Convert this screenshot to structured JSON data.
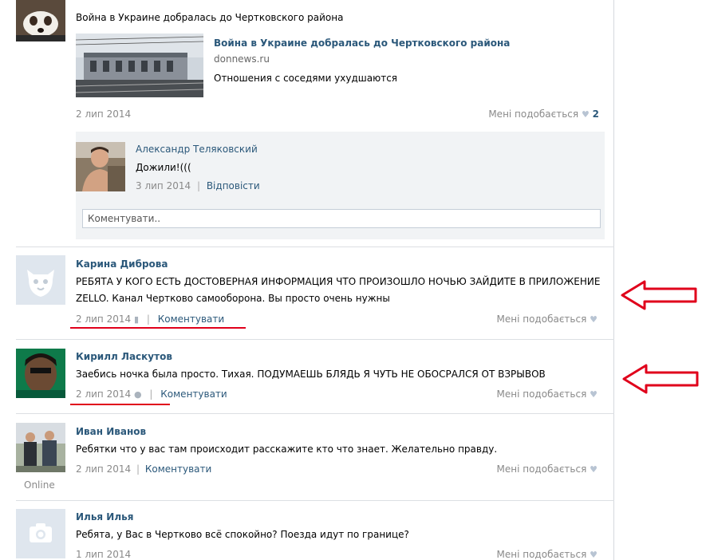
{
  "repost": {
    "text": "Война в Украине добралась до Чертковского района",
    "link_title": "Война в Украине добралась до Чертковского района",
    "link_domain": "donnews.ru",
    "link_desc": "Отношения с соседями ухудшаются",
    "date": "2 лип 2014",
    "likes_label": "Мені подобається",
    "likes_count": "2"
  },
  "reply": {
    "author": "Александр Теляковский",
    "text": "Дожили!(((",
    "date": "3 лип 2014",
    "reply_label": "Відповісти"
  },
  "comment_input": {
    "placeholder": "Коментувати.."
  },
  "comments": [
    {
      "name": "Карина Диброва",
      "text": "РЕБЯТА У КОГО ЕСТЬ ДОСТОВЕРНАЯ ИНФОРМАЦИЯ ЧТО ПРОИЗОШЛО НОЧЬЮ ЗАЙДИТЕ В ПРИЛОЖЕНИЕ ZELLO. Канал Чертково самооборона. Вы просто очень нужны",
      "date": "2 лип 2014",
      "comment_label": "Коментувати",
      "likes_label": "Мені подобається"
    },
    {
      "name": "Кирилл Ласкутов",
      "text": "Заебись ночка была просто. Тихая. ПОДУМАЕШЬ БЛЯДЬ Я ЧУТЬ НЕ ОБОСРАЛСЯ ОТ ВЗРЫВОВ",
      "date": "2 лип 2014",
      "comment_label": "Коментувати",
      "likes_label": "Мені подобається"
    },
    {
      "name": "Иван Иванов",
      "text": "Ребятки что у вас там происходит расскажите кто что знает. Желательно правду.",
      "date": "2 лип 2014",
      "comment_label": "Коментувати",
      "likes_label": "Мені подобається",
      "status": "Online"
    },
    {
      "name": "Илья Илья",
      "text": "Ребята, у Вас в Чертково всё спокойно? Поезда идут по границе?",
      "date": "1 лип 2014",
      "likes_label": "Мені подобається"
    }
  ],
  "colors": {
    "link": "#2b587a",
    "muted": "#8a8a8a",
    "annotation": "#e0001b",
    "separator": "#dcdfe3"
  }
}
